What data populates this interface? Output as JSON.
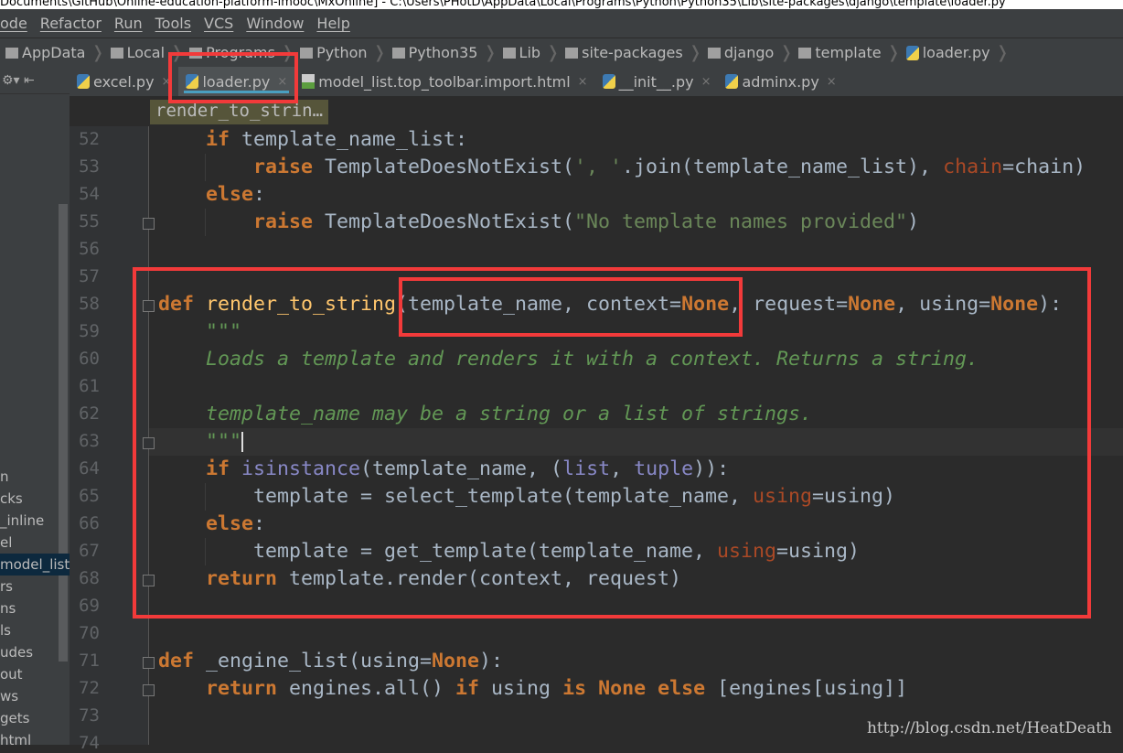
{
  "window_title": "Documents\\GitHub\\Online-education-platform-imooc\\MxOnline] - C:\\Users\\PHotD\\AppData\\Local\\Programs\\Python\\Python35\\Lib\\site-packages\\django\\template\\loader.py",
  "menu": [
    "ode",
    "Refactor",
    "Run",
    "Tools",
    "VCS",
    "Window",
    "Help"
  ],
  "breadcrumbs": [
    "AppData",
    "Local",
    "Programs",
    "Python",
    "Python35",
    "Lib",
    "site-packages",
    "django",
    "template",
    "loader.py"
  ],
  "tabs": [
    {
      "label": "excel.py",
      "icon": "python-file-icon",
      "active": false
    },
    {
      "label": "loader.py",
      "icon": "python-file-icon",
      "active": true
    },
    {
      "label": "model_list.top_toolbar.import.html",
      "icon": "html-file-icon",
      "active": false
    },
    {
      "label": "__init__.py",
      "icon": "python-file-icon",
      "active": false
    },
    {
      "label": "adminx.py",
      "icon": "python-file-icon",
      "active": false
    }
  ],
  "close_glyph": "×",
  "structure_breadcrumb": "render_to_strin…",
  "project_tree": [
    "n",
    "cks",
    "_inline",
    "el",
    "model_list.",
    "rs",
    "ns",
    "ls",
    "udes",
    "out",
    "ws",
    "gets",
    "html"
  ],
  "project_tree_selected": 4,
  "code_lines": [
    {
      "n": "52",
      "indent": 1,
      "t": [
        [
          "if",
          "k"
        ],
        [
          " template_name_list:",
          ""
        ]
      ]
    },
    {
      "n": "53",
      "indent": 2,
      "t": [
        [
          "raise",
          "k"
        ],
        [
          " TemplateDoesNotExist(",
          ""
        ],
        [
          "', '",
          "s"
        ],
        [
          ".join(template_name_list), ",
          ""
        ],
        [
          "chain",
          "p"
        ],
        [
          "=chain)",
          ""
        ]
      ]
    },
    {
      "n": "54",
      "indent": 1,
      "t": [
        [
          "else",
          "k"
        ],
        [
          ":",
          ""
        ]
      ]
    },
    {
      "n": "55",
      "indent": 2,
      "t": [
        [
          "raise",
          "k"
        ],
        [
          " TemplateDoesNotExist(",
          ""
        ],
        [
          "\"No template names provided\"",
          "s"
        ],
        [
          ")",
          ""
        ]
      ]
    },
    {
      "n": "56",
      "indent": 0,
      "t": []
    },
    {
      "n": "57",
      "indent": 0,
      "t": []
    },
    {
      "n": "58",
      "indent": 0,
      "t": [
        [
          "def",
          "k"
        ],
        [
          " ",
          ""
        ],
        [
          "render_to_string",
          "fn"
        ],
        [
          "(template_name, context=",
          ""
        ],
        [
          "None",
          "k"
        ],
        [
          ", request=",
          ""
        ],
        [
          "None",
          "k"
        ],
        [
          ", using=",
          ""
        ],
        [
          "None",
          "k"
        ],
        [
          "):",
          ""
        ]
      ]
    },
    {
      "n": "59",
      "indent": 1,
      "t": [
        [
          "\"\"\"",
          "d"
        ]
      ]
    },
    {
      "n": "60",
      "indent": 1,
      "t": [
        [
          "Loads a template and renders it with a context. Returns a string.",
          "d"
        ]
      ]
    },
    {
      "n": "61",
      "indent": 0,
      "t": []
    },
    {
      "n": "62",
      "indent": 1,
      "t": [
        [
          "template_name may be a string or a list of strings.",
          "d"
        ]
      ]
    },
    {
      "n": "63",
      "indent": 1,
      "t": [
        [
          "\"\"\"",
          "d"
        ]
      ]
    },
    {
      "n": "64",
      "indent": 1,
      "t": [
        [
          "if",
          "k"
        ],
        [
          " ",
          ""
        ],
        [
          "isinstance",
          "b"
        ],
        [
          "(template_name, (",
          ""
        ],
        [
          "list",
          "b"
        ],
        [
          ", ",
          ""
        ],
        [
          "tuple",
          "b"
        ],
        [
          ")):",
          ""
        ]
      ]
    },
    {
      "n": "65",
      "indent": 2,
      "t": [
        [
          "template = select_template(template_name, ",
          ""
        ],
        [
          "using",
          "p"
        ],
        [
          "=using)",
          ""
        ]
      ]
    },
    {
      "n": "66",
      "indent": 1,
      "t": [
        [
          "else",
          "k"
        ],
        [
          ":",
          ""
        ]
      ]
    },
    {
      "n": "67",
      "indent": 2,
      "t": [
        [
          "template = get_template(template_name, ",
          ""
        ],
        [
          "using",
          "p"
        ],
        [
          "=using)",
          ""
        ]
      ]
    },
    {
      "n": "68",
      "indent": 1,
      "t": [
        [
          "return",
          "k"
        ],
        [
          " template.render(context, request)",
          ""
        ]
      ]
    },
    {
      "n": "69",
      "indent": 0,
      "t": []
    },
    {
      "n": "70",
      "indent": 0,
      "t": []
    },
    {
      "n": "71",
      "indent": 0,
      "t": [
        [
          "def",
          "k"
        ],
        [
          " _engine_list(using=",
          ""
        ],
        [
          "None",
          "k"
        ],
        [
          "):",
          ""
        ]
      ]
    },
    {
      "n": "72",
      "indent": 1,
      "t": [
        [
          "return",
          "k"
        ],
        [
          " engines.all() ",
          ""
        ],
        [
          "if",
          "k"
        ],
        [
          " using ",
          ""
        ],
        [
          "is",
          "k"
        ],
        [
          " ",
          ""
        ],
        [
          "None",
          "k"
        ],
        [
          " ",
          ""
        ],
        [
          "else",
          "k"
        ],
        [
          " [engines[using]]",
          ""
        ]
      ]
    },
    {
      "n": "73",
      "indent": 0,
      "t": []
    },
    {
      "n": "74",
      "indent": 0,
      "t": []
    }
  ],
  "watermark": "http://blog.csdn.net/HeatDeath",
  "colors": {
    "annotation_red": "#f23a3a",
    "editor_bg": "#2b2b2b",
    "keyword": "#cc7832",
    "string": "#6a8759",
    "docstring": "#629755"
  }
}
